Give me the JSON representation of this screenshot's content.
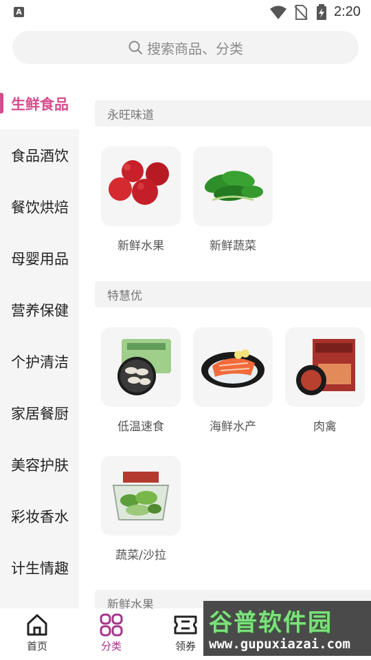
{
  "status_bar": {
    "time": "2:20",
    "notification_letter": "A"
  },
  "search": {
    "placeholder": "搜索商品、分类"
  },
  "sidebar": {
    "items": [
      {
        "label": "生鲜食品",
        "active": true
      },
      {
        "label": "食品酒饮",
        "active": false
      },
      {
        "label": "餐饮烘焙",
        "active": false
      },
      {
        "label": "母婴用品",
        "active": false
      },
      {
        "label": "营养保健",
        "active": false
      },
      {
        "label": "个护清洁",
        "active": false
      },
      {
        "label": "家居餐厨",
        "active": false
      },
      {
        "label": "美容护肤",
        "active": false
      },
      {
        "label": "彩妆香水",
        "active": false
      },
      {
        "label": "计生情趣",
        "active": false
      }
    ]
  },
  "sections": [
    {
      "title": "永旺味道",
      "items": [
        {
          "label": "新鲜水果",
          "icon": "apples"
        },
        {
          "label": "新鲜蔬菜",
          "icon": "greens"
        }
      ]
    },
    {
      "title": "特慧优",
      "items": [
        {
          "label": "低温速食",
          "icon": "dumplings"
        },
        {
          "label": "海鲜水产",
          "icon": "salmon"
        },
        {
          "label": "肉禽",
          "icon": "meat-box"
        },
        {
          "label": "蔬菜/沙拉",
          "icon": "salad"
        }
      ]
    },
    {
      "title": "新鲜水果",
      "items": []
    }
  ],
  "bottom_nav": {
    "items": [
      {
        "label": "首页",
        "icon": "home-icon",
        "active": false
      },
      {
        "label": "分类",
        "icon": "category-icon",
        "active": true
      },
      {
        "label": "领券",
        "icon": "coupon-icon",
        "active": false
      }
    ]
  },
  "watermark": {
    "title": "谷普软件园",
    "url": "www.gupuxiazai.com"
  },
  "colors": {
    "accent": "#d84b8c",
    "nav_active": "#a5348a",
    "sidebar_bg": "#f5f5f5"
  }
}
